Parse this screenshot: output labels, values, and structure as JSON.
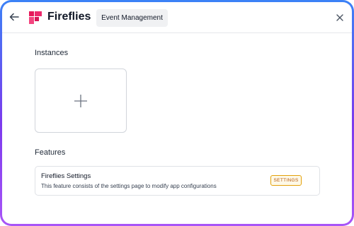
{
  "header": {
    "app_name": "Fireflies",
    "active_tab": "Event Management"
  },
  "instances": {
    "title": "Instances",
    "add_symbol": "+"
  },
  "features": {
    "title": "Features",
    "items": [
      {
        "name": "Fireflies Settings",
        "description": "This feature consists of the settings page to modify app configurations",
        "badge": "SETTINGS"
      }
    ]
  },
  "colors": {
    "brand": "#e5195a",
    "frame_top": "#3b82f6",
    "frame_bottom": "#a855f7",
    "badge_border": "#e3a008"
  },
  "icons": [
    "back-arrow-icon",
    "fireflies-logo",
    "close-icon",
    "plus-icon"
  ]
}
